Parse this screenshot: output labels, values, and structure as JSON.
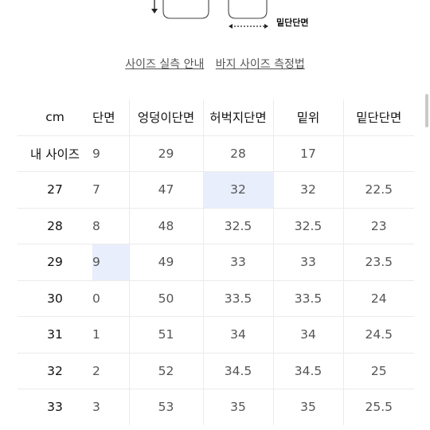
{
  "diagram": {
    "bottom_hem_label": "밑단단면"
  },
  "links": {
    "size_guide": "사이즈 실측 안내",
    "pants_measure": "바지 사이즈 측정법"
  },
  "table": {
    "headers": [
      "cm",
      "단면",
      "엉덩이단면",
      "허벅지단면",
      "밑위",
      "밑단단면"
    ],
    "rows": [
      [
        "내 사이즈",
        "9",
        "29",
        "28",
        "17",
        ""
      ],
      [
        "27",
        "7",
        "47",
        "32",
        "32",
        "22.5"
      ],
      [
        "28",
        "8",
        "48",
        "32.5",
        "32.5",
        "23"
      ],
      [
        "29",
        "9",
        "49",
        "33",
        "33",
        "23.5"
      ],
      [
        "30",
        "0",
        "50",
        "33.5",
        "33.5",
        "24"
      ],
      [
        "31",
        "1",
        "51",
        "34",
        "34",
        "24.5"
      ],
      [
        "32",
        "2",
        "52",
        "34.5",
        "34.5",
        "25"
      ],
      [
        "33",
        "3",
        "53",
        "35",
        "35",
        "25.5"
      ]
    ]
  },
  "colors": {
    "highlight": "#e9eefc",
    "border": "#ebebeb"
  }
}
